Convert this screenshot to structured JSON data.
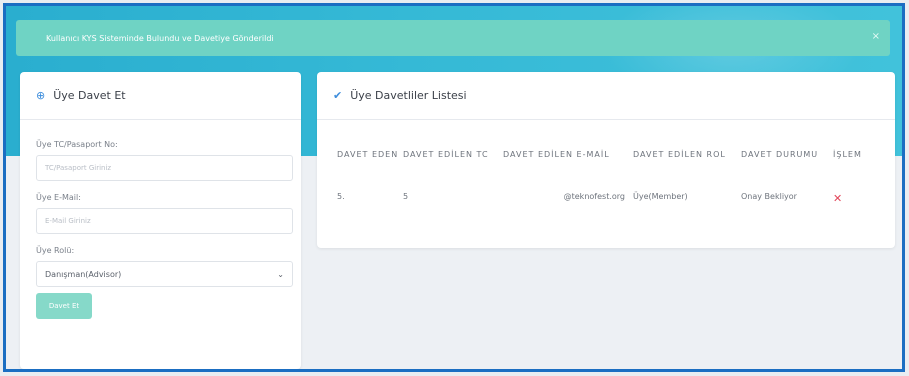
{
  "alert": {
    "text": "Kullanıcı KYS Sisteminde Bulundu ve Davetiye Gönderildi",
    "close": "×"
  },
  "invite_form": {
    "title": "Üye Davet Et",
    "icon": "plus-circle-icon",
    "tc_label": "Üye TC/Pasaport No:",
    "tc_placeholder": "TC/Pasaport Giriniz",
    "email_label": "Üye E-Mail:",
    "email_placeholder": "E-Mail Giriniz",
    "role_label": "Üye Rolü:",
    "role_value": "Danışman(Advisor)",
    "submit_label": "Davet Et"
  },
  "invites": {
    "title": "Üye Davetliler Listesi",
    "icon": "check-icon",
    "columns": [
      "DAVET EDEN",
      "DAVET EDİLEN TC",
      "DAVET EDİLEN E-MAİL",
      "DAVET EDİLEN ROL",
      "DAVET DURUMU",
      "İŞLEM"
    ],
    "rows": [
      {
        "inviter": "5.",
        "tc": "5",
        "email": "@teknofest.org",
        "role": "Üye(Member)",
        "status": "Onay Bekliyor",
        "action": "✕"
      }
    ]
  },
  "colors": {
    "hero": "#2aaecf",
    "alert": "#6fd3c4",
    "button": "#86d9c9",
    "accent": "#3d8ddc",
    "delete": "#e2465a",
    "frame": "#1b6ec2"
  }
}
